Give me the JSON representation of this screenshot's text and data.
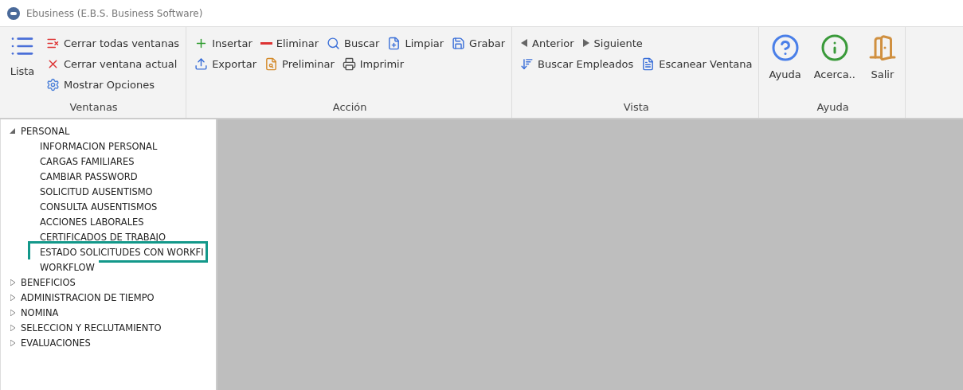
{
  "window": {
    "title": "Ebusiness (E.B.S. Business Software)"
  },
  "ribbon": {
    "groups": [
      {
        "label": "Ventanas",
        "large": [
          {
            "label": "Lista"
          }
        ],
        "lines": [
          {
            "buttons": [
              {
                "label": "Cerrar todas ventanas"
              }
            ]
          },
          {
            "buttons": [
              {
                "label": "Cerrar ventana actual"
              }
            ]
          },
          {
            "buttons": [
              {
                "label": "Mostrar Opciones"
              }
            ]
          }
        ]
      },
      {
        "label": "Acción",
        "lines": [
          {
            "buttons": [
              {
                "label": "Insertar"
              },
              {
                "label": "Eliminar"
              },
              {
                "label": "Buscar"
              },
              {
                "label": "Limpiar"
              },
              {
                "label": "Grabar"
              }
            ]
          },
          {
            "buttons": [
              {
                "label": "Exportar"
              },
              {
                "label": "Preliminar"
              },
              {
                "label": "Imprimir"
              }
            ]
          }
        ]
      },
      {
        "label": "Vista",
        "lines": [
          {
            "buttons": [
              {
                "label": "Anterior"
              },
              {
                "label": "Siguiente"
              }
            ]
          },
          {
            "buttons": [
              {
                "label": "Buscar Empleados"
              },
              {
                "label": "Escanear Ventana"
              }
            ]
          }
        ]
      },
      {
        "label": "Ayuda",
        "large": [
          {
            "label": "Ayuda"
          },
          {
            "label": "Acerca.."
          },
          {
            "label": "Salir"
          }
        ]
      }
    ]
  },
  "tree": [
    {
      "label": "PERSONAL",
      "expanded": true,
      "children": [
        {
          "label": "INFORMACION PERSONAL",
          "selected": false
        },
        {
          "label": "CARGAS FAMILIARES",
          "selected": false
        },
        {
          "label": "CAMBIAR PASSWORD",
          "selected": false
        },
        {
          "label": "SOLICITUD AUSENTISMO",
          "selected": false
        },
        {
          "label": "CONSULTA AUSENTISMOS",
          "selected": false
        },
        {
          "label": "ACCIONES LABORALES",
          "selected": false
        },
        {
          "label": "CERTIFICADOS DE TRABAJO",
          "selected": false
        },
        {
          "label": "ESTADO SOLICITUDES CON WORKFI",
          "selected": true
        },
        {
          "label": "WORKFLOW",
          "selected": false
        }
      ]
    },
    {
      "label": "BENEFICIOS",
      "expanded": false
    },
    {
      "label": "ADMINISTRACION DE TIEMPO",
      "expanded": false
    },
    {
      "label": "NOMINA",
      "expanded": false
    },
    {
      "label": "SELECCION Y RECLUTAMIENTO",
      "expanded": false
    },
    {
      "label": "EVALUACIONES",
      "expanded": false
    }
  ]
}
